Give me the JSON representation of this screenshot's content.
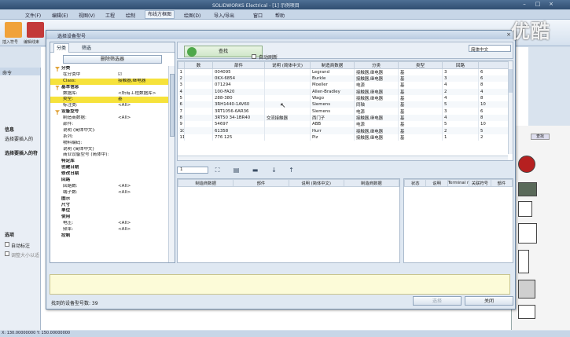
{
  "app": {
    "title": "SOLIDWORKS Electrical - [1] 示例项目",
    "menus": [
      "文件(F)",
      "编辑(E)",
      "视图(V)",
      "工程",
      "绘制",
      "布线方框图",
      "绘图(D)",
      "导入/导出",
      "窗口",
      "帮助"
    ],
    "active_menu": "布线方框图",
    "ribbon_labels": [
      "插入符号",
      "编辑线束"
    ],
    "left_panel": {
      "header": "命令",
      "info_label": "信息",
      "prompt1": "选择要插入的",
      "prompt2": "选择要插入的符",
      "options_label": "选项",
      "auto_label": "自动标注",
      "adjust_label": "调整大小以适"
    },
    "right_panel": {
      "tab": "查找"
    },
    "statusbar": "X: 130.00000000  Y: 150.00000000"
  },
  "dialog": {
    "title": "选择设备型号",
    "tabs": [
      "分类",
      "筛选"
    ],
    "delete_filter": "删除筛选器",
    "search_button": "查找",
    "auto_refresh": "自动刷新",
    "language": "简体中文",
    "properties": [
      {
        "key": "分类",
        "value": "",
        "type": "header",
        "icon": "funnel-icon"
      },
      {
        "key": "在分类中",
        "value": "☑",
        "type": "row"
      },
      {
        "key": "Class:",
        "value": "接触器,继电器",
        "type": "highlight"
      },
      {
        "key": "基本信息",
        "value": "",
        "type": "header",
        "icon": "funnel-icon"
      },
      {
        "key": "数据库:",
        "value": "<所有工程数据库>",
        "type": "row"
      },
      {
        "key": "类型:",
        "value": "基",
        "type": "highlight"
      },
      {
        "key": "标注类:",
        "value": "<All>",
        "type": "row"
      },
      {
        "key": "设备型号",
        "value": "",
        "type": "header",
        "icon": "funnel-icon"
      },
      {
        "key": "制造商数据:",
        "value": "<All>",
        "type": "row"
      },
      {
        "key": "部件:",
        "value": "",
        "type": "row"
      },
      {
        "key": "说明 (简体中文):",
        "value": "",
        "type": "row"
      },
      {
        "key": "系列:",
        "value": "",
        "type": "row"
      },
      {
        "key": "物料编码:",
        "value": "",
        "type": "row"
      },
      {
        "key": "说明 (简体中文)",
        "value": "",
        "type": "row"
      },
      {
        "key": "商业设备型号 (简体中):",
        "value": "",
        "type": "row"
      },
      {
        "key": "特定库",
        "value": "",
        "type": "header"
      },
      {
        "key": "创建日期",
        "value": "",
        "type": "header"
      },
      {
        "key": "修改日期",
        "value": "",
        "type": "header"
      },
      {
        "key": "回路",
        "value": "",
        "type": "header"
      },
      {
        "key": "回路数:",
        "value": "<All>",
        "type": "row"
      },
      {
        "key": "端子数:",
        "value": "<All>",
        "type": "row"
      },
      {
        "key": "图示",
        "value": "",
        "type": "header"
      },
      {
        "key": "尺寸",
        "value": "",
        "type": "header"
      },
      {
        "key": "单位",
        "value": "",
        "type": "header"
      },
      {
        "key": "使用",
        "value": "",
        "type": "header"
      },
      {
        "key": "电压:",
        "value": "<All>",
        "type": "row"
      },
      {
        "key": "频率:",
        "value": "<All>",
        "type": "row"
      },
      {
        "key": "控制",
        "value": "",
        "type": "header"
      }
    ],
    "grid": {
      "columns": [
        "",
        "数",
        "部件",
        "说明 (简体中文)",
        "制造商数据",
        "分类",
        "类型",
        "回路",
        ""
      ],
      "rows": [
        [
          "1",
          "",
          "004095",
          "",
          "Legrand",
          "接触器,继电器",
          "基",
          "3",
          "6"
        ],
        [
          "2",
          "",
          "0KX-6854",
          "",
          "Burkle",
          "接触器,继电器",
          "基",
          "3",
          "6"
        ],
        [
          "3",
          "",
          "071294",
          "",
          "Moeller",
          "电源",
          "基",
          "4",
          "8"
        ],
        [
          "4",
          "",
          "100-FA20",
          "",
          "Allen-Bradley",
          "接触器,继电器",
          "基",
          "2",
          "4"
        ],
        [
          "5",
          "",
          "288-380",
          "",
          "Wago",
          "接触器,继电器",
          "基",
          "4",
          "8"
        ],
        [
          "6",
          "",
          "3RH1440-1AV60",
          "",
          "Siemens",
          "同轴",
          "基",
          "5",
          "10"
        ],
        [
          "7",
          "",
          "3RT1056-6AR36",
          "",
          "Siemens",
          "电源",
          "基",
          "3",
          "6"
        ],
        [
          "8",
          "",
          "3RT50 34-1BR40",
          "交流接触器",
          "西门子",
          "接触器,继电器",
          "基",
          "4",
          "8"
        ],
        [
          "9",
          "",
          "54697",
          "",
          "ABB",
          "电源",
          "基",
          "5",
          "10"
        ],
        [
          "10",
          "",
          "61358",
          "",
          "Hurr",
          "接触器,继电器",
          "基",
          "2",
          "5"
        ],
        [
          "11",
          "",
          "776 125",
          "",
          "Piz",
          "接触器,继电器",
          "基",
          "1",
          "2"
        ]
      ]
    },
    "page": "1",
    "sub_left_columns": [
      "制造商数据",
      "部件",
      "说明 (简体中文)",
      "制造商数据"
    ],
    "sub_right_columns": [
      "状态",
      "说明",
      "Terminal number",
      "关联符号",
      "部件"
    ],
    "found_label": "找到的设备型号数: 39",
    "buttons": {
      "select": "选择",
      "close": "关闭"
    }
  },
  "watermark": "优酷"
}
